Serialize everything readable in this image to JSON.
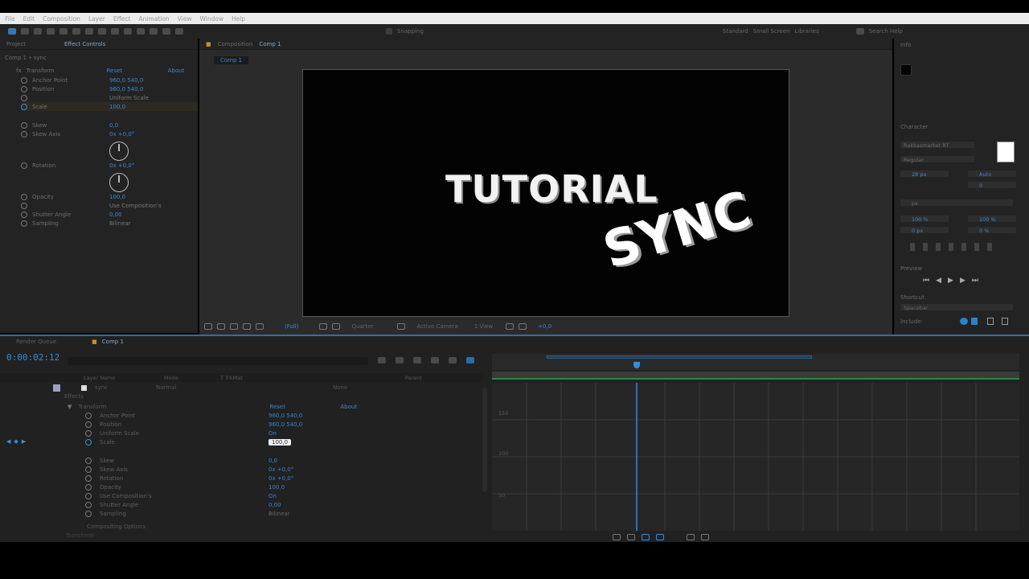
{
  "menubar": {
    "items": [
      "File",
      "Edit",
      "Composition",
      "Layer",
      "Effect",
      "Animation",
      "View",
      "Window",
      "Help"
    ]
  },
  "toolbar": {
    "snapping_label": "Snapping",
    "workspace_items": [
      "Standard",
      "Small Screen",
      "Libraries"
    ],
    "search_label": "Search Help"
  },
  "effect_controls": {
    "tabs": [
      "Project",
      "Effect Controls"
    ],
    "layer_path": "Comp 1 • sync",
    "group_label": "Transform",
    "reset_label": "Reset",
    "about_label": "About",
    "properties": [
      {
        "name": "Anchor Point",
        "value": "960,0  540,0"
      },
      {
        "name": "Position",
        "value": "960,0  540,0"
      },
      {
        "name": "",
        "value": "Uniform Scale"
      },
      {
        "name": "Scale",
        "value": "100,0"
      },
      {
        "name": "Skew",
        "value": "0,0"
      },
      {
        "name": "Skew Axis",
        "value": "0x +0,0°"
      },
      {
        "name": "Rotation",
        "value": "0x +0,0°"
      },
      {
        "name": "Opacity",
        "value": "100,0"
      },
      {
        "name": "",
        "value": "Use Composition's"
      },
      {
        "name": "Shutter Angle",
        "value": "0,00"
      },
      {
        "name": "Sampling",
        "value": "Bilinear"
      }
    ]
  },
  "viewer": {
    "tab_label": "Composition",
    "comp_name": "Comp 1",
    "breadcrumb": "Comp 1",
    "text_tutorial": "TUTORIAL",
    "text_sync": "SYNC",
    "zoom": "(Full)",
    "quality_label": "Quarter",
    "camera_label": "Active Camera",
    "view_label": "1 View",
    "exposure_value": "+0,0"
  },
  "right_panels": {
    "info_title": "Info",
    "character_title": "Character",
    "font_family": "Rakkasmarket RT",
    "font_style": "Regular",
    "font_size": "28 px",
    "leading": "Auto",
    "tracking": "0",
    "stroke": "px",
    "scale_v": "100 %",
    "scale_h": "100 %",
    "baseline": "0 px",
    "tsume": "0 %",
    "preview_title": "Preview",
    "shortcut_label": "Shortcut",
    "spacebar_label": "Spacebar",
    "include_label": "Include:"
  },
  "timeline": {
    "tabs": [
      "Render Queue",
      "Comp 1"
    ],
    "timecode": "0:00:02:12",
    "columns": [
      "Layer Name",
      "Mode",
      "T TrkMat",
      "Parent"
    ],
    "layer_name": "sync",
    "layer_mode": "Normal",
    "parent": "None",
    "group_effects": "Effects",
    "group_transform": "Transform",
    "reset_label": "Reset",
    "about_label": "About",
    "rows": [
      {
        "name": "Anchor Point",
        "value": "960,0  540,0"
      },
      {
        "name": "Position",
        "value": "960,0  540,0"
      },
      {
        "name": "Uniform Scale",
        "value": "On"
      },
      {
        "name": "Scale",
        "value": "100,0"
      },
      {
        "name": "Skew",
        "value": "0,0"
      },
      {
        "name": "Skew Axis",
        "value": "0x +0,0°"
      },
      {
        "name": "Rotation",
        "value": "0x +0,0°"
      },
      {
        "name": "Opacity",
        "value": "100,0"
      },
      {
        "name": "Use Composition's",
        "value": "On"
      },
      {
        "name": "Shutter Angle",
        "value": "0,00"
      },
      {
        "name": "Sampling",
        "value": "Bilinear"
      }
    ],
    "compositing_label": "Compositing Options",
    "transform_label": "Transform",
    "graph_labels": [
      "150",
      "100",
      "50"
    ]
  },
  "colors": {
    "accent_blue": "#3b8fd6",
    "work_area_green": "#1f8f3c",
    "panel_bg": "#232323",
    "viewer_bg": "#2b2b2b"
  }
}
